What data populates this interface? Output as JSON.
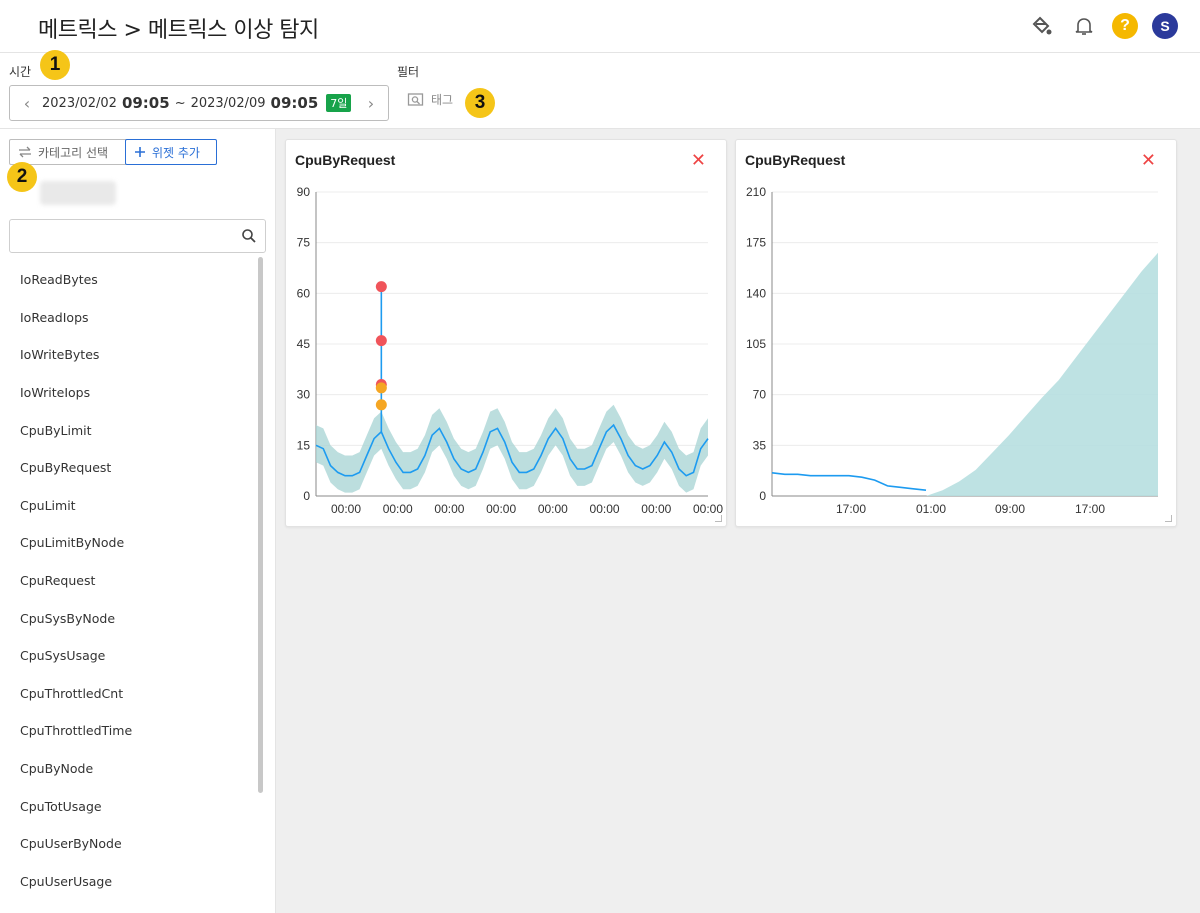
{
  "header": {
    "title": "메트릭스 > 메트릭스 이상 탐지",
    "icons": [
      "paint-bucket-icon",
      "bell-icon",
      "help-icon",
      "avatar"
    ],
    "help_label": "?",
    "avatar_initial": "S",
    "colors": {
      "help": "#f5b800",
      "avatar": "#2b3a9b"
    }
  },
  "filter": {
    "time_label": "시간",
    "filter_label": "필터",
    "start_date": "2023/02/02",
    "start_time": "09:05",
    "tilde": "~",
    "end_date": "2023/02/09",
    "end_time": "09:05",
    "days_badge": "7일",
    "tag_label": "태그"
  },
  "callouts": [
    "1",
    "2",
    "3"
  ],
  "sidebar": {
    "category_button": "카테고리 선택",
    "add_widget_button": "위젯 추가",
    "search_placeholder": "",
    "metrics": [
      "IoReadBytes",
      "IoReadIops",
      "IoWriteBytes",
      "IoWriteIops",
      "CpuByLimit",
      "CpuByRequest",
      "CpuLimit",
      "CpuLimitByNode",
      "CpuRequest",
      "CpuSysByNode",
      "CpuSysUsage",
      "CpuThrottledCnt",
      "CpuThrottledTime",
      "CpuByNode",
      "CpuTotUsage",
      "CpuUserByNode",
      "CpuUserUsage"
    ]
  },
  "widgets": [
    {
      "title": "CpuByRequest",
      "close": "✕"
    },
    {
      "title": "CpuByRequest",
      "close": "✕"
    }
  ],
  "chart_data": [
    {
      "type": "line",
      "title": "CpuByRequest",
      "ylim": [
        0,
        90
      ],
      "yticks": [
        0,
        15,
        30,
        45,
        60,
        75,
        90
      ],
      "xtick_labels": [
        "00:00",
        "00:00",
        "00:00",
        "00:00",
        "00:00",
        "00:00",
        "00:00",
        "00:00"
      ],
      "series": [
        {
          "values": [
            15,
            14,
            9,
            7,
            6,
            6,
            7,
            12,
            17,
            19,
            14,
            10,
            7,
            7,
            8,
            12,
            18,
            20,
            16,
            11,
            8,
            7,
            8,
            13,
            19,
            20,
            16,
            10,
            7,
            7,
            8,
            12,
            17,
            20,
            17,
            11,
            8,
            8,
            9,
            14,
            19,
            21,
            17,
            12,
            9,
            8,
            9,
            12,
            16,
            13,
            8,
            6,
            7,
            14,
            17
          ]
        }
      ],
      "band": {
        "upper_offset": 6,
        "lower_offset": 5,
        "color": "#a6d3d3"
      },
      "anomalies": [
        {
          "x_index": 9,
          "y": 62,
          "color": "#f0545a"
        },
        {
          "x_index": 9,
          "y": 46,
          "color": "#f0545a"
        },
        {
          "x_index": 9,
          "y": 33,
          "color": "#f0545a"
        },
        {
          "x_index": 9,
          "y": 32,
          "color": "#f5a623"
        },
        {
          "x_index": 9,
          "y": 27,
          "color": "#f5a623"
        }
      ],
      "line_color": "#1d9bf0",
      "grid": true
    },
    {
      "type": "area",
      "title": "CpuByRequest",
      "ylim": [
        0,
        210
      ],
      "yticks": [
        0,
        35,
        70,
        105,
        140,
        175,
        210
      ],
      "xtick_labels": [
        "17:00",
        "01:00",
        "09:00",
        "17:00"
      ],
      "series": [
        {
          "values": [
            16,
            15,
            15,
            14,
            14,
            14,
            14,
            13,
            11,
            7,
            6,
            5,
            4
          ]
        },
        {
          "values": [
            0,
            4,
            10,
            18,
            30,
            42,
            55,
            68,
            80,
            95,
            110,
            125,
            140,
            155,
            168
          ]
        }
      ],
      "line_color": "#1d9bf0",
      "area_color": "#b7dfe0",
      "grid": true
    }
  ]
}
